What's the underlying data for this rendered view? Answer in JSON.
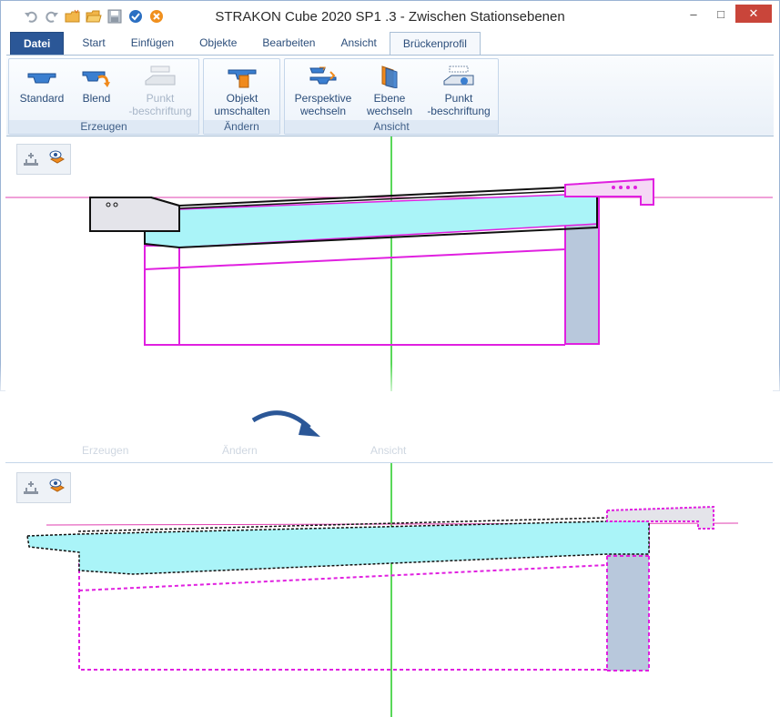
{
  "window": {
    "title": "STRAKON Cube 2020 SP1 .3 - Zwischen Stationsebenen",
    "controls": {
      "minimize": "–",
      "maximize": "□",
      "close": "✕"
    }
  },
  "quick_access": [
    "undo-icon",
    "redo-icon",
    "folder-new-icon",
    "folder-open-icon",
    "save-icon",
    "confirm-icon",
    "cancel-icon"
  ],
  "tabs": [
    {
      "label": "Datei"
    },
    {
      "label": "Start"
    },
    {
      "label": "Einfügen"
    },
    {
      "label": "Objekte"
    },
    {
      "label": "Bearbeiten"
    },
    {
      "label": "Ansicht"
    },
    {
      "label": "Brückenprofil",
      "active": true
    }
  ],
  "ribbon": {
    "erzeugen": {
      "label": "Erzeugen",
      "standard": "Standard",
      "blend": "Blend",
      "punkt1": "Punkt",
      "punkt2": "-beschriftung"
    },
    "aendern": {
      "label": "Ändern",
      "objekt1": "Objekt",
      "objekt2": "umschalten"
    },
    "ansicht": {
      "label": "Ansicht",
      "persp1": "Perspektive",
      "persp2": "wechseln",
      "ebene1": "Ebene",
      "ebene2": "wechseln",
      "punkt1": "Punkt",
      "punkt2": "-beschriftung"
    }
  },
  "ghost": {
    "erzeugen": "Erzeugen",
    "aendern": "Ändern",
    "ansicht": "Ansicht"
  },
  "colors": {
    "accent": "#2b5797",
    "magenta": "#e020e0",
    "cyan_fill": "#aaf4f8",
    "steel_fill": "#b8c8dc",
    "axis_green": "#22cc22"
  }
}
